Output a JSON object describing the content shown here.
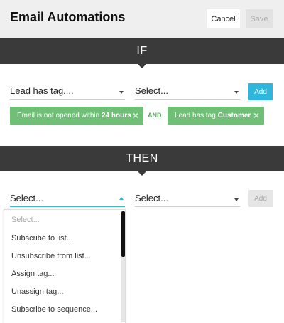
{
  "header": {
    "title": "Email Automations",
    "cancel_label": "Cancel",
    "save_label": "Save"
  },
  "if_section": {
    "label": "IF",
    "trigger_select": "Lead has tag....",
    "value_select": "Select...",
    "add_label": "Add",
    "and_label": "AND",
    "conditions": [
      {
        "text": "Email is not opened within",
        "bold": "24 hours"
      },
      {
        "text": "Lead has tag",
        "bold": "Customer"
      }
    ]
  },
  "then_section": {
    "label": "THEN",
    "action_select": "Select...",
    "value_select": "Select...",
    "add_label": "Add",
    "dropdown_options": [
      "Select...",
      "Subscribe to list...",
      "Unsubscribe from list...",
      "Assign tag...",
      "Unassign tag...",
      "Subscribe to sequence..."
    ]
  },
  "colors": {
    "accent": "#2fb6dc",
    "chip_green": "#6fbf76",
    "section_bar": "#3a3a3a"
  },
  "icons": {
    "remove": "close-icon",
    "dropdown": "caret-down-icon"
  }
}
